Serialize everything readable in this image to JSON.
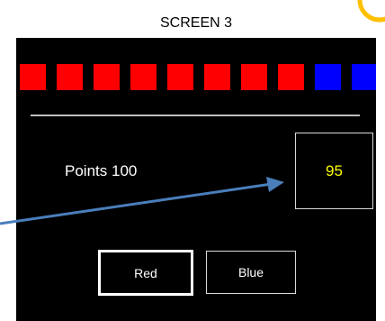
{
  "caption": "SCREEN 3",
  "squares": {
    "items": [
      {
        "color": "red"
      },
      {
        "color": "red"
      },
      {
        "color": "red"
      },
      {
        "color": "red"
      },
      {
        "color": "red"
      },
      {
        "color": "red"
      },
      {
        "color": "red"
      },
      {
        "color": "red"
      },
      {
        "color": "blue"
      },
      {
        "color": "blue"
      }
    ]
  },
  "points": {
    "label": "Points",
    "value": "100"
  },
  "value_box": "95",
  "buttons": {
    "red": "Red",
    "blue": "Blue"
  },
  "colors": {
    "background": "#000000",
    "square_red": "#ff0000",
    "square_blue": "#0000ff",
    "value_text": "#ffff00",
    "arrow": "#4a7ebb",
    "logo": "#ffc000"
  },
  "icons": {
    "corner": "orange-circle-logo-icon",
    "annotation": "pointer-arrow-icon"
  }
}
